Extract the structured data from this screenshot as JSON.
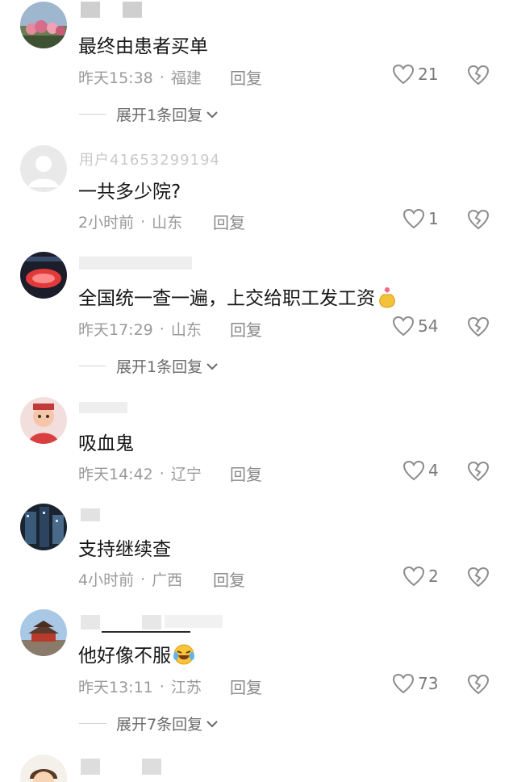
{
  "comments": [
    {
      "username": "",
      "content": "最终由患者买单",
      "time": "昨天15:38",
      "location": "福建",
      "reply_label": "回复",
      "likes": "21",
      "expand_label": "展开1条回复"
    },
    {
      "username": "用户41653299194",
      "content": "一共多少院?",
      "time": "2小时前",
      "location": "山东",
      "reply_label": "回复",
      "likes": "1"
    },
    {
      "username": "",
      "content": "全国统一查一遍，上交给职工发工资",
      "time": "昨天17:29",
      "location": "山东",
      "reply_label": "回复",
      "likes": "54",
      "expand_label": "展开1条回复"
    },
    {
      "username": "",
      "content": "吸血鬼",
      "time": "昨天14:42",
      "location": "辽宁",
      "reply_label": "回复",
      "likes": "4"
    },
    {
      "username": "",
      "content": "支持继续查",
      "time": "4小时前",
      "location": "广西",
      "reply_label": "回复",
      "likes": "2"
    },
    {
      "username": "",
      "content": "他好像不服",
      "time": "昨天13:11",
      "location": "江苏",
      "reply_label": "回复",
      "likes": "73",
      "expand_label": "展开7条回复"
    }
  ],
  "meta_separator": "·",
  "icons": {
    "like": "heart-outline-icon",
    "dislike": "broken-heart-icon",
    "expand": "chevron-down-icon",
    "emoji_money_bag": "money-bag-emoji",
    "emoji_laugh_cry": "laughing-crying-emoji"
  },
  "colors": {
    "text_primary": "#161616",
    "text_meta": "#9a9a9a",
    "icon_gray": "#8c8c8c"
  }
}
